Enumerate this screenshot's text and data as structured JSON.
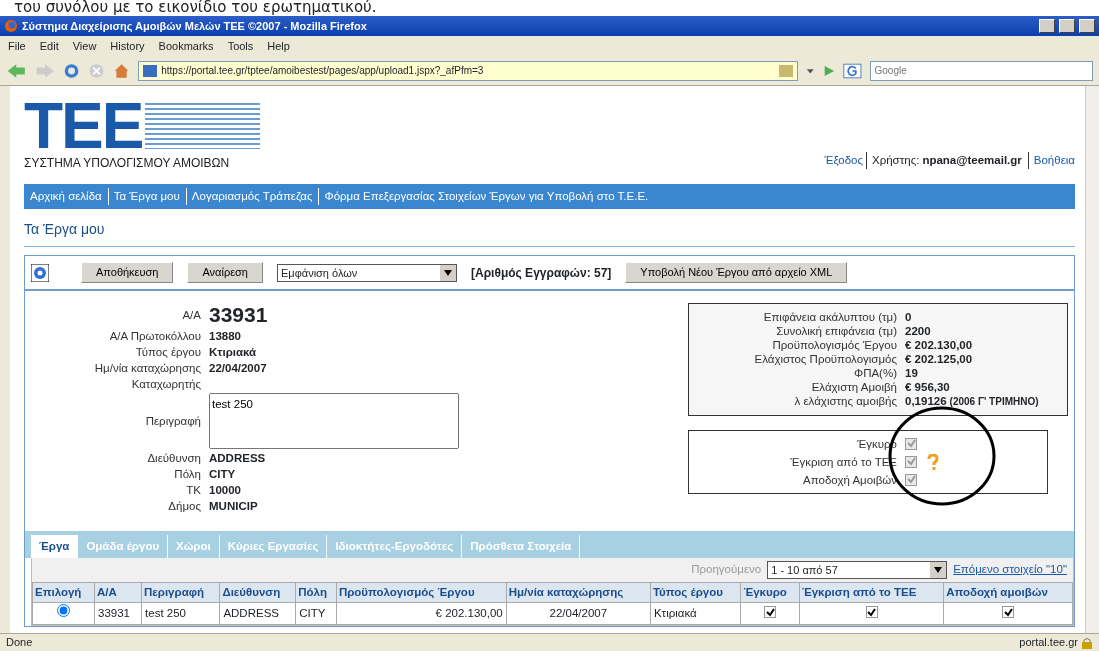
{
  "caption_fragment": "του συνόλου με το εικονίδιο του ερωτηματικού.",
  "window": {
    "title": "Σύστημα Διαχείρισης Αμοιβών Μελών ΤΕΕ ©2007 - Mozilla Firefox"
  },
  "menu": [
    "File",
    "Edit",
    "View",
    "History",
    "Bookmarks",
    "Tools",
    "Help"
  ],
  "toolbar": {
    "url": "https://portal.tee.gr/tptee/amoibestest/pages/app/upload1.jspx?_afPfm=3",
    "search_placeholder": "Google"
  },
  "header": {
    "logo": "ΤΕΕ",
    "subtitle": "ΣΥΣΤΗΜΑ ΥΠΟΛΟΓΙΣΜΟΥ ΑΜΟΙΒΩΝ",
    "logout": "Έξοδος",
    "user_label": "Χρήστης:",
    "user": "npana@teemail.gr",
    "help": "Βοήθεια"
  },
  "nav": [
    "Αρχική σελίδα",
    "Τα Έργα μου",
    "Λογαριασμός Τράπεζας",
    "Φόρμα Επεξεργασίας Στοιχείων Έργων για Υποβολή στο Τ.Ε.Ε."
  ],
  "page_title": "Τα Έργα μου",
  "actions": {
    "save": "Αποθήκευση",
    "cancel": "Αναίρεση",
    "filter": "Εμφάνιση όλων",
    "count": "[Αριθμός Εγγραφών: 57]",
    "upload": "Υποβολή Νέου Έργου από αρχείο XML"
  },
  "record": [
    {
      "kind": "big",
      "label": "Α/Α",
      "value": "33931"
    },
    {
      "kind": "text",
      "label": "Α/Α Πρωτοκόλλου",
      "value": "13880"
    },
    {
      "kind": "text",
      "label": "Τύπος έργου",
      "value": "Κτιριακά"
    },
    {
      "kind": "text",
      "label": "Ημ/νία καταχώρησης",
      "value": "22/04/2007"
    },
    {
      "kind": "text",
      "label": "Καταχωρητής"
    },
    {
      "kind": "textarea",
      "label": "Περιγραφή",
      "value": "test 250"
    },
    {
      "kind": "text",
      "label": "Διεύθυνση",
      "value": "ADDRESS"
    },
    {
      "kind": "text",
      "label": "Πόλη",
      "value": "CITY"
    },
    {
      "kind": "text",
      "label": "ΤΚ",
      "value": "10000"
    },
    {
      "kind": "text",
      "label": "Δήμος",
      "value": "MUNICIP"
    }
  ],
  "summary": [
    {
      "label": "Επιφάνεια ακάλυπτου (τμ)",
      "value": "0"
    },
    {
      "label": "Συνολική επιφάνεια (τμ)",
      "value": "2200"
    },
    {
      "label": "Προϋπολογισμός Έργου",
      "value": "€ 202.130,00"
    },
    {
      "label": "Ελάχιστος Προϋπολογισμός",
      "value": "€ 202.125,00"
    },
    {
      "label": "ΦΠΑ(%)",
      "value": "19"
    },
    {
      "label": "Ελάχιστη Αμοιβή",
      "value": "€ 956,30"
    },
    {
      "label": "λ ελάχιστης αμοιβής",
      "value": "0,19126",
      "note": "(2006 Γ' ΤΡΙΜΗΝΟ)"
    }
  ],
  "flags": [
    {
      "label": "Έγκυρο",
      "checked": true,
      "disabled": true,
      "help": false
    },
    {
      "label": "Έγκριση από το ΤΕΕ",
      "checked": true,
      "disabled": true,
      "help": true
    },
    {
      "label": "Αποδοχή Αμοιβών",
      "checked": true,
      "disabled": true,
      "help": false
    }
  ],
  "tabs": [
    {
      "label": "Έργα",
      "selected": true
    },
    {
      "label": "Ομάδα έργου",
      "selected": false
    },
    {
      "label": "Χώροι",
      "selected": false
    },
    {
      "label": "Κύριες Εργασίες",
      "selected": false
    },
    {
      "label": "Ιδιοκτήτες-Εργοδότες",
      "selected": false
    },
    {
      "label": "Πρόσθετα Στοιχεία",
      "selected": false
    }
  ],
  "pager": {
    "previous": "Προηγούμενο",
    "previous_disabled": true,
    "range": "1 - 10 από 57",
    "next": "Επόμενο στοιχείο \"10\""
  },
  "table": {
    "columns": [
      "Επιλογή",
      "Α/Α",
      "Περιγραφή",
      "Διεύθυνση",
      "Πόλη",
      "Προϋπολογισμός Έργου",
      "Ημ/νία καταχώρησης",
      "Τύπος έργου",
      "Έγκυρο",
      "Έγκριση από το ΤΕΕ",
      "Αποδοχή αμοιβών"
    ],
    "rows": [
      {
        "selected": true,
        "cells": [
          "",
          "33931",
          "test 250",
          "ADDRESS",
          "CITY",
          "€ 202.130,00",
          "22/04/2007",
          "Κτιριακά"
        ],
        "valid": true,
        "approved": true,
        "accepted": true
      }
    ]
  },
  "status_bar": {
    "text": "Done",
    "host": "portal.tee.gr"
  }
}
